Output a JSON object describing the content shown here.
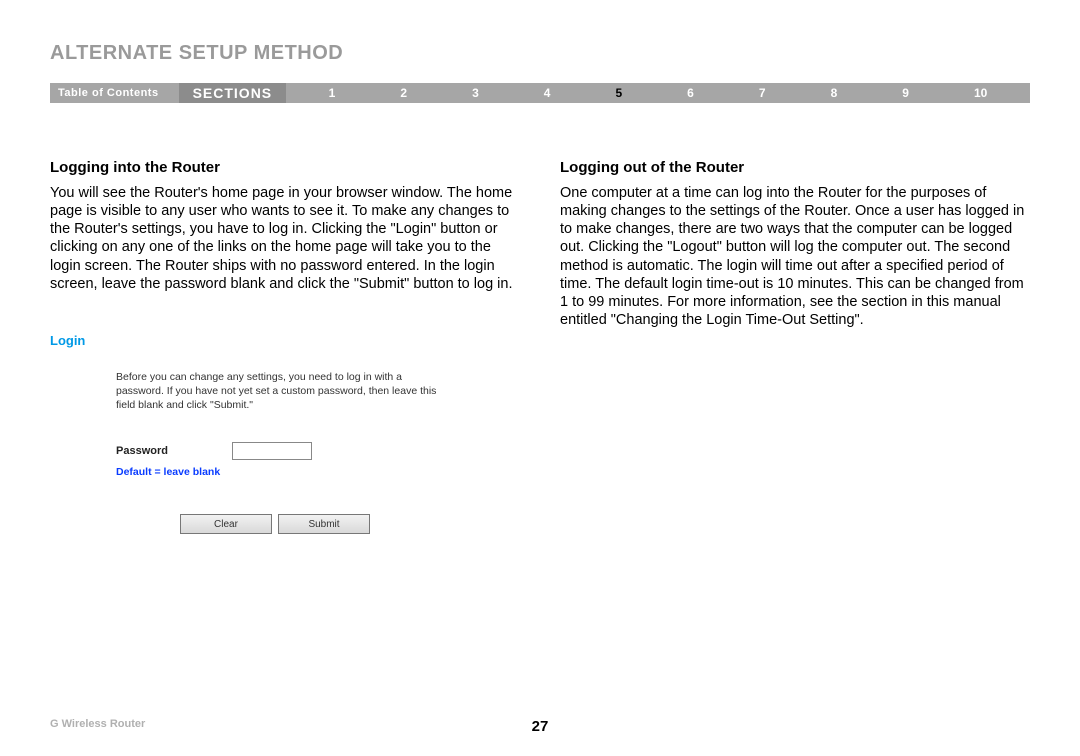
{
  "page_title": "ALTERNATE SETUP METHOD",
  "nav": {
    "toc_label": "Table of Contents",
    "sections_label": "SECTIONS",
    "items": [
      "1",
      "2",
      "3",
      "4",
      "5",
      "6",
      "7",
      "8",
      "9",
      "10"
    ],
    "current": "5"
  },
  "left": {
    "heading": "Logging into the Router",
    "body": "You will see the Router's home page in your browser window. The home page is visible to any user who wants to see it. To make any changes to the Router's settings, you have to log in. Clicking the \"Login\" button or clicking on any one of the links on the home page will take you to the login screen. The Router ships with no password entered. In the login screen, leave the password blank and click the \"Submit\" button to log in."
  },
  "right": {
    "heading": "Logging out of the Router",
    "body": "One computer at a time can log into the Router for the purposes of making changes to the settings of the Router. Once a user has logged in to make changes, there are two ways that the computer can be logged out. Clicking the \"Logout\" button will log the computer out. The second method is automatic. The login will time out after a specified period of time. The default login time-out is 10 minutes. This can be changed from 1 to 99 minutes. For more information, see the section in this manual entitled \"Changing the Login Time-Out Setting\"."
  },
  "login_panel": {
    "heading": "Login",
    "instructions": "Before you can change any settings, you need to log in with a password. If you have not yet set a custom password, then leave this field blank and click \"Submit.\"",
    "password_label": "Password",
    "password_value": "",
    "hint": "Default = leave blank",
    "clear_label": "Clear",
    "submit_label": "Submit"
  },
  "footer": {
    "product": "G Wireless Router",
    "page_number": "27"
  }
}
